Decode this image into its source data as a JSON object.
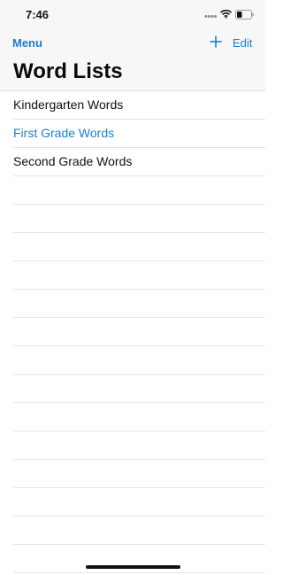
{
  "status_bar": {
    "time": "7:46",
    "icons": [
      "signal-dots-icon",
      "wifi-icon",
      "battery-icon"
    ]
  },
  "nav": {
    "menu_label": "Menu",
    "add_icon": "plus-icon",
    "edit_label": "Edit"
  },
  "title": "Word Lists",
  "word_lists": [
    {
      "label": "Kindergarten Words",
      "selected": false
    },
    {
      "label": "First Grade Words",
      "selected": true
    },
    {
      "label": "Second Grade Words",
      "selected": false
    }
  ],
  "colors": {
    "accent": "#1b7fd1",
    "header_bg": "#f7f7f7",
    "separator": "#e3e3e3",
    "text": "#111111"
  }
}
